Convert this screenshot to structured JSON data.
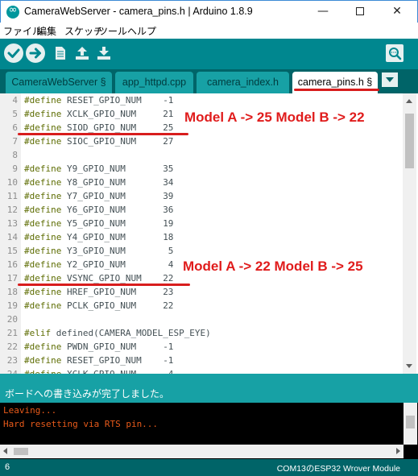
{
  "window": {
    "title": "CameraWebServer - camera_pins.h | Arduino 1.8.9",
    "controls": {
      "minimize": "—",
      "close": "✕"
    }
  },
  "menu": [
    "ファイル",
    "編集",
    "スケッチ",
    "ツール",
    "ヘルプ"
  ],
  "toolbar": {
    "buttons": [
      "verify-icon",
      "upload-icon",
      "new-icon",
      "open-icon",
      "save-icon"
    ],
    "serial_monitor": "serial-monitor-icon"
  },
  "tabs": [
    {
      "label": "CameraWebServer §",
      "active": false
    },
    {
      "label": "app_httpd.cpp",
      "active": false
    },
    {
      "label": "camera_index.h",
      "active": false
    },
    {
      "label": "camera_pins.h §",
      "active": true
    }
  ],
  "editor": {
    "lines": [
      {
        "num": "4",
        "directive": "#define",
        "text": " RESET_GPIO_NUM    -1"
      },
      {
        "num": "5",
        "directive": "#define",
        "text": " XCLK_GPIO_NUM     21"
      },
      {
        "num": "6",
        "directive": "#define",
        "text": " SIOD_GPIO_NUM     25"
      },
      {
        "num": "7",
        "directive": "#define",
        "text": " SIOC_GPIO_NUM     27"
      },
      {
        "num": "8",
        "directive": "",
        "text": ""
      },
      {
        "num": "9",
        "directive": "#define",
        "text": " Y9_GPIO_NUM       35"
      },
      {
        "num": "10",
        "directive": "#define",
        "text": " Y8_GPIO_NUM       34"
      },
      {
        "num": "11",
        "directive": "#define",
        "text": " Y7_GPIO_NUM       39"
      },
      {
        "num": "12",
        "directive": "#define",
        "text": " Y6_GPIO_NUM       36"
      },
      {
        "num": "13",
        "directive": "#define",
        "text": " Y5_GPIO_NUM       19"
      },
      {
        "num": "14",
        "directive": "#define",
        "text": " Y4_GPIO_NUM       18"
      },
      {
        "num": "15",
        "directive": "#define",
        "text": " Y3_GPIO_NUM        5"
      },
      {
        "num": "16",
        "directive": "#define",
        "text": " Y2_GPIO_NUM        4"
      },
      {
        "num": "17",
        "directive": "#define",
        "text": " VSYNC_GPIO_NUM    22"
      },
      {
        "num": "18",
        "directive": "#define",
        "text": " HREF_GPIO_NUM     23"
      },
      {
        "num": "19",
        "directive": "#define",
        "text": " PCLK_GPIO_NUM     22"
      },
      {
        "num": "20",
        "directive": "",
        "text": ""
      },
      {
        "num": "21",
        "directive": "#elif",
        "text": " defined(CAMERA_MODEL_ESP_EYE)"
      },
      {
        "num": "22",
        "directive": "#define",
        "text": " PWDN_GPIO_NUM     -1"
      },
      {
        "num": "23",
        "directive": "#define",
        "text": " RESET_GPIO_NUM    -1"
      },
      {
        "num": "24",
        "directive": "#define",
        "text": " XCLK_GPIO_NUM      4"
      }
    ]
  },
  "annotations": {
    "siod": "Model A -> 25   Model B -> 22",
    "vsync": "Model A -> 22  Model B -> 25",
    "color": "#e01c1c"
  },
  "status_message": "ボードへの書き込みが完了しました。",
  "console": {
    "lines": [
      "Leaving...",
      "Hard resetting via RTS pin..."
    ]
  },
  "statusbar": {
    "line_number": "6",
    "board": "COM13のESP32 Wrover Module"
  },
  "colors": {
    "toolbar": "#00878f",
    "tabbar": "#006468",
    "tab_inactive": "#17a1a5",
    "console_text": "#e85a1a"
  }
}
